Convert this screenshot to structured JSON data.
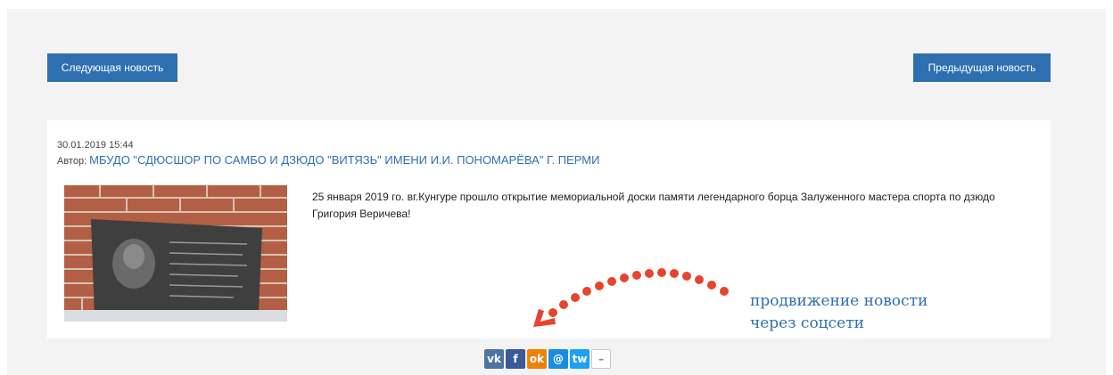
{
  "navigation": {
    "next_label": "Следующая новость",
    "prev_label": "Предыдущая новость"
  },
  "article": {
    "date": "30.01.2019 15:44",
    "author_prefix": "Автор:",
    "author_name": "МБУДО \"СДЮСШОР ПО САМБО И ДЗЮДО \"ВИТЯЗЬ\" ИМЕНИ И.И. ПОНОМАРЁВА\" Г. ПЕРМИ",
    "text": "25 января 2019 го. вг.Кунгуре прошло открытие мемориальной доски памяти легендарного борца Залуженного мастера спорта по дзюдо Григория Веричева!"
  },
  "annotation": {
    "line1": "продвижение новости",
    "line2": "через соцсети"
  },
  "share": {
    "buttons": [
      {
        "icon": "vk-icon",
        "glyph": "vk"
      },
      {
        "icon": "facebook-icon",
        "glyph": "f"
      },
      {
        "icon": "odnoklassniki-icon",
        "glyph": "ok"
      },
      {
        "icon": "moimir-icon",
        "glyph": "@"
      },
      {
        "icon": "twitter-icon",
        "glyph": "tw"
      },
      {
        "icon": "more-icon",
        "glyph": "–"
      }
    ]
  },
  "colors": {
    "accent": "#2e6fb0",
    "panel_bg": "#f3f3f3",
    "annotation_dots": "#e8432e"
  }
}
